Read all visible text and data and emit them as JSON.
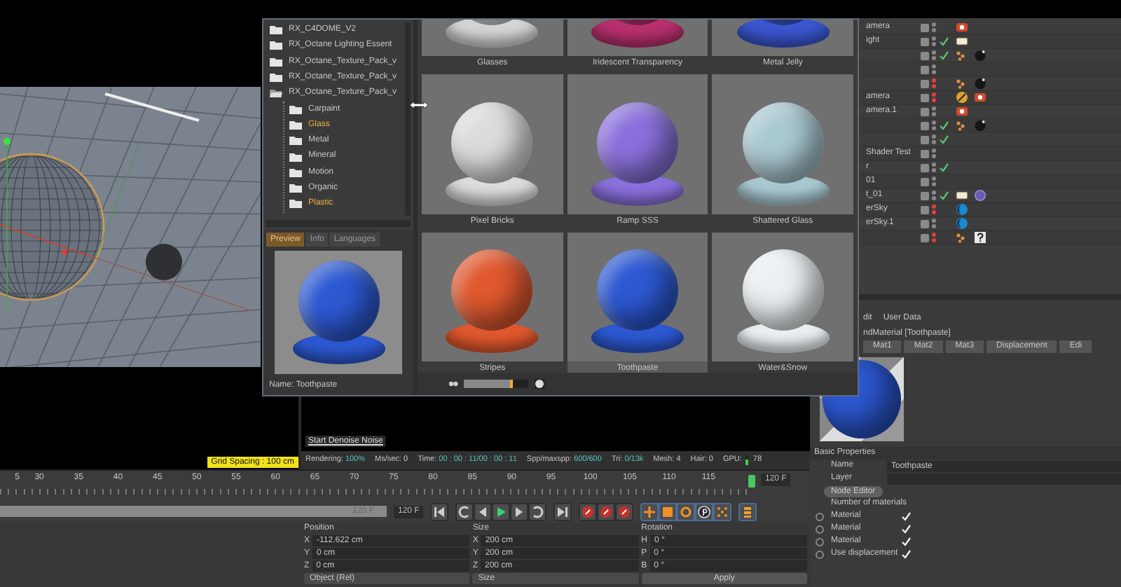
{
  "viewport": {
    "grid_spacing": "Grid Spacing : 100 cm"
  },
  "render_view": {
    "overlay_label": "Start Denoise Noise",
    "status": [
      {
        "label": "Rendering:",
        "value": "100%",
        "highlight": true
      },
      {
        "label": "Ms/sec:",
        "value": "0",
        "highlight": false
      },
      {
        "label": "Time:",
        "value": "00 : 00 : 11/00 : 00 : 11",
        "highlight": true
      },
      {
        "label": "Spp/maxspp:",
        "value": "600/600",
        "highlight": true
      },
      {
        "label": "Tri:",
        "value": "0/13k",
        "highlight": true
      },
      {
        "label": "Mesh:",
        "value": "4",
        "highlight": false
      },
      {
        "label": "Hair:",
        "value": "0",
        "highlight": false
      },
      {
        "label": "GPU:",
        "value": "78",
        "highlight": false,
        "level": 0.6
      }
    ]
  },
  "material_browser": {
    "tree": [
      {
        "label": "RX_C4DOME_V2",
        "expanded": false
      },
      {
        "label": "RX_Octane Lighting Essent",
        "expanded": false
      },
      {
        "label": "RX_Octane_Texture_Pack_v",
        "expanded": false
      },
      {
        "label": "RX_Octane_Texture_Pack_v",
        "expanded": false
      },
      {
        "label": "RX_Octane_Texture_Pack_v",
        "expanded": true,
        "children": [
          {
            "label": "Carpaint",
            "selected": false
          },
          {
            "label": "Glass",
            "selected": true
          },
          {
            "label": "Metal",
            "selected": false
          },
          {
            "label": "Mineral",
            "selected": false
          },
          {
            "label": "Motion",
            "selected": false
          },
          {
            "label": "Organic",
            "selected": false
          },
          {
            "label": "Plastic",
            "selected": true
          }
        ]
      }
    ],
    "preview_tabs": [
      {
        "label": "Preview",
        "selected": true
      },
      {
        "label": "Info",
        "selected": false
      },
      {
        "label": "Languages",
        "selected": false
      }
    ],
    "preview_name": "Name: Toothpaste",
    "materials": [
      {
        "label": "Glasses",
        "color": "#d4d4d4",
        "selected": false
      },
      {
        "label": "Iridescent Transparency",
        "color": "#b8306e",
        "selected": false
      },
      {
        "label": "Metal Jelly",
        "color": "#3a56d0",
        "selected": false
      },
      {
        "label": "Pixel Bricks",
        "color": "#dcdcdc",
        "selected": false
      },
      {
        "label": "Ramp SSS",
        "color": "#8a70dc",
        "selected": false
      },
      {
        "label": "Shattered Glass",
        "color": "#a9c9d2",
        "selected": false
      },
      {
        "label": "Stripes",
        "color": "#e0582e",
        "selected": false
      },
      {
        "label": "Toothpaste",
        "color": "#2c58d2",
        "selected": true
      },
      {
        "label": "Water&Snow",
        "color": "#eaf0f2",
        "selected": false
      }
    ],
    "zoom_slider": {
      "level": 0.75
    }
  },
  "object_manager": {
    "rows": [
      {
        "name": "amera",
        "hidden": false,
        "enabled": false,
        "tags": [
          {
            "kind": "camera"
          }
        ]
      },
      {
        "name": "ight",
        "hidden": false,
        "enabled": true,
        "tags": [
          {
            "kind": "light"
          }
        ]
      },
      {
        "hidden": false,
        "enabled": true,
        "tags": [
          {
            "kind": "dots"
          },
          {
            "kind": "ball"
          }
        ]
      },
      {
        "hidden": false,
        "enabled": false,
        "tags": []
      },
      {
        "hidden": true,
        "enabled": false,
        "tags": [
          {
            "kind": "dots"
          },
          {
            "kind": "ball"
          }
        ]
      },
      {
        "name": "amera",
        "hidden": true,
        "enabled": false,
        "tags": [
          {
            "kind": "striped"
          },
          {
            "kind": "camera"
          }
        ]
      },
      {
        "name": "amera.1",
        "hidden": false,
        "enabled": false,
        "tags": [
          {
            "kind": "camera"
          }
        ]
      },
      {
        "hidden": false,
        "enabled": true,
        "tags": [
          {
            "kind": "dots"
          },
          {
            "kind": "ball"
          }
        ]
      },
      {
        "hidden": false,
        "enabled": true,
        "tags": []
      },
      {
        "name": "Shader Test",
        "hidden": false,
        "enabled": false,
        "tags": []
      },
      {
        "name": "r",
        "hidden": false,
        "enabled": true,
        "tags": []
      },
      {
        "name": "01",
        "hidden": false,
        "enabled": false,
        "tags": []
      },
      {
        "name": "t_01",
        "hidden": false,
        "enabled": true,
        "tags": [
          {
            "kind": "light"
          },
          {
            "kind": "circle"
          }
        ]
      },
      {
        "name": "erSky",
        "hidden": true,
        "enabled": false,
        "tags": [
          {
            "kind": "sky"
          }
        ]
      },
      {
        "name": "erSky.1",
        "hidden": false,
        "enabled": false,
        "tags": [
          {
            "kind": "sky"
          }
        ]
      },
      {
        "hidden": true,
        "enabled": false,
        "tags": [
          {
            "kind": "dots"
          },
          {
            "kind": "question"
          }
        ]
      }
    ]
  },
  "attribute_manager": {
    "menu": [
      "dit",
      "User Data"
    ],
    "title": "ndMaterial [Toothpaste]",
    "tabs": [
      "Mat1",
      "Mat2",
      "Mat3",
      "Displacement",
      "Edi"
    ],
    "section": "Basic Properties",
    "fields": [
      {
        "kind": "text",
        "label": "Name",
        "value": "Toothpaste"
      },
      {
        "kind": "text",
        "label": "Layer"
      },
      {
        "kind": "button",
        "label": "Node Editor"
      },
      {
        "kind": "label",
        "label": "Number of materials"
      },
      {
        "kind": "check",
        "label": "Material",
        "checked": true
      },
      {
        "kind": "check",
        "label": "Material",
        "checked": true
      },
      {
        "kind": "check",
        "label": "Material",
        "checked": true
      },
      {
        "kind": "check",
        "label": "Use displacement",
        "checked": true
      }
    ]
  },
  "timeline": {
    "ticks": [
      "5",
      "30",
      "35",
      "40",
      "45",
      "50",
      "55",
      "60",
      "65",
      "70",
      "75",
      "80",
      "85",
      "90",
      "95",
      "100",
      "105",
      "110",
      "115"
    ],
    "end_field": "120 F"
  },
  "transport": {
    "slider_label": "120 F",
    "level": 1,
    "frame_field": "120 F"
  },
  "coordinates": {
    "headers": [
      "Position",
      "Size",
      "Rotation"
    ],
    "rows": [
      [
        {
          "axis": "X",
          "value": "-112.622 cm"
        },
        {
          "axis": "X",
          "value": "200 cm"
        },
        {
          "axis": "H",
          "value": "0 °"
        }
      ],
      [
        {
          "axis": "Y",
          "value": "0 cm"
        },
        {
          "axis": "Y",
          "value": "200 cm"
        },
        {
          "axis": "P",
          "value": "0 °"
        }
      ],
      [
        {
          "axis": "Z",
          "value": "0 cm"
        },
        {
          "axis": "Z",
          "value": "200 cm"
        },
        {
          "axis": "B",
          "value": "0 °"
        }
      ]
    ],
    "mode": "Object (Rel)",
    "size_mode": "Size",
    "apply": "Apply"
  }
}
